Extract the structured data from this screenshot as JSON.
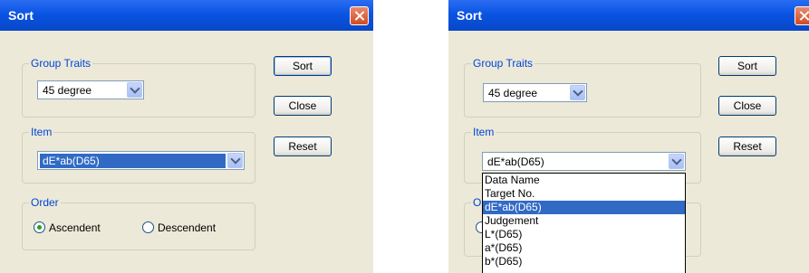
{
  "dialog_left": {
    "title": "Sort",
    "group_traits": {
      "label": "Group Traits",
      "value": "45 degree"
    },
    "item": {
      "label": "Item",
      "value": "dE*ab(D65)"
    },
    "order": {
      "label": "Order",
      "ascendent": "Ascendent",
      "descendent": "Descendent",
      "selected": "Ascendent"
    },
    "buttons": {
      "sort": "Sort",
      "close": "Close",
      "reset": "Reset"
    }
  },
  "dialog_right": {
    "title": "Sort",
    "group_traits": {
      "label": "Group Traits",
      "value": "45 degree"
    },
    "item": {
      "label": "Item",
      "value": "dE*ab(D65)",
      "options": [
        "Data Name",
        "Target No.",
        "dE*ab(D65)",
        "Judgement",
        "L*(D65)",
        "a*(D65)",
        "b*(D65)"
      ],
      "highlighted": "dE*ab(D65)"
    },
    "buttons": {
      "sort": "Sort",
      "close": "Close",
      "reset": "Reset"
    }
  }
}
